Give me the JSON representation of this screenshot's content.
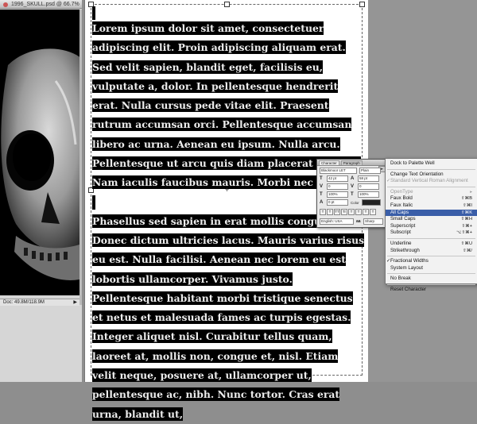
{
  "image_window": {
    "title": "1996_SKULL.psd @ 66.7%",
    "status": "Doc: 49.8M/118.9M"
  },
  "document": {
    "paragraph1": "Lorem ipsum dolor sit amet, consectetuer adipiscing elit. Proin adipiscing aliquam erat. Sed velit sapien, blandit eget, facilisis eu, vulputate a, dolor. In pellentesque hendrerit erat. Nulla cursus pede vitae elit. Praesent rutrum accumsan orci. Pellentesque accumsan libero ac urna. Aenean eu ipsum. Nulla arcu. Pellentesque ut arcu quis diam placerat sodales. Nam iaculis faucibus mauris. Morbi nec dui.",
    "paragraph2": "Phasellus sed sapien in erat mollis congue. Donec dictum ultricies lacus. Mauris varius risus eu est. Nulla facilisi. Aenean nec lorem eu est lobortis ullamcorper. Vivamus justo. Pellentesque habitant morbi tristique senectus et netus et malesuada fames ac turpis egestas. Integer aliquet nisl. Curabitur tellus quam, laoreet at, mollis non, congue et, nisl. Etiam velit neque, posuere at, ullamcorper ut, pellentesque ac, nibh. Nunc tortor. Cras erat urna, blandit ut,"
  },
  "character_palette": {
    "tabs": [
      "Character",
      "Paragraph"
    ],
    "font_family": "Blackmoor LET",
    "font_style": "Plain",
    "font_size": "42 pt",
    "leading": "58 pt",
    "tracking": "0",
    "kerning": "0",
    "vertical_scale": "100%",
    "horizontal_scale": "100%",
    "baseline_shift": "0 pt",
    "color_label": "Color",
    "language": "English: USA",
    "antialias": "Sharp",
    "style_buttons": [
      "T",
      "T",
      "TT",
      "Tr",
      "T",
      "T",
      "T",
      "T"
    ]
  },
  "flyout_menu": {
    "items": [
      {
        "label": "Dock to Palette Well",
        "shortcut": "",
        "disabled": false,
        "selected": false,
        "checked": false
      },
      {
        "separator": true
      },
      {
        "label": "Change Text Orientation",
        "shortcut": "",
        "disabled": false,
        "selected": false,
        "checked": false
      },
      {
        "label": "Standard Vertical Roman Alignment",
        "shortcut": "",
        "disabled": true,
        "selected": false,
        "checked": true
      },
      {
        "separator": true
      },
      {
        "label": "OpenType",
        "shortcut": "▸",
        "disabled": true,
        "selected": false,
        "checked": false
      },
      {
        "label": "Faux Bold",
        "shortcut": "⇧⌘B",
        "disabled": false,
        "selected": false,
        "checked": false
      },
      {
        "label": "Faux Italic",
        "shortcut": "⇧⌘I",
        "disabled": false,
        "selected": false,
        "checked": false
      },
      {
        "label": "All Caps",
        "shortcut": "⇧⌘K",
        "disabled": false,
        "selected": true,
        "checked": false
      },
      {
        "label": "Small Caps",
        "shortcut": "⇧⌘H",
        "disabled": false,
        "selected": false,
        "checked": false
      },
      {
        "label": "Superscript",
        "shortcut": "⇧⌘+",
        "disabled": false,
        "selected": false,
        "checked": false
      },
      {
        "label": "Subscript",
        "shortcut": "⌥⇧⌘+",
        "disabled": false,
        "selected": false,
        "checked": false
      },
      {
        "separator": true
      },
      {
        "label": "Underline",
        "shortcut": "⇧⌘U",
        "disabled": false,
        "selected": false,
        "checked": false
      },
      {
        "label": "Strikethrough",
        "shortcut": "⇧⌘/",
        "disabled": false,
        "selected": false,
        "checked": false
      },
      {
        "separator": true
      },
      {
        "label": "Fractional Widths",
        "shortcut": "",
        "disabled": false,
        "selected": false,
        "checked": true
      },
      {
        "label": "System Layout",
        "shortcut": "",
        "disabled": false,
        "selected": false,
        "checked": false
      },
      {
        "separator": true
      },
      {
        "label": "No Break",
        "shortcut": "",
        "disabled": false,
        "selected": false,
        "checked": false
      },
      {
        "separator": true
      },
      {
        "label": "Reset Character",
        "shortcut": "",
        "disabled": false,
        "selected": false,
        "checked": false
      }
    ]
  },
  "colors": {
    "menu_highlight": "#3a5ea8",
    "text_highlight": "#000000",
    "highlighted_text": "#ececec"
  }
}
